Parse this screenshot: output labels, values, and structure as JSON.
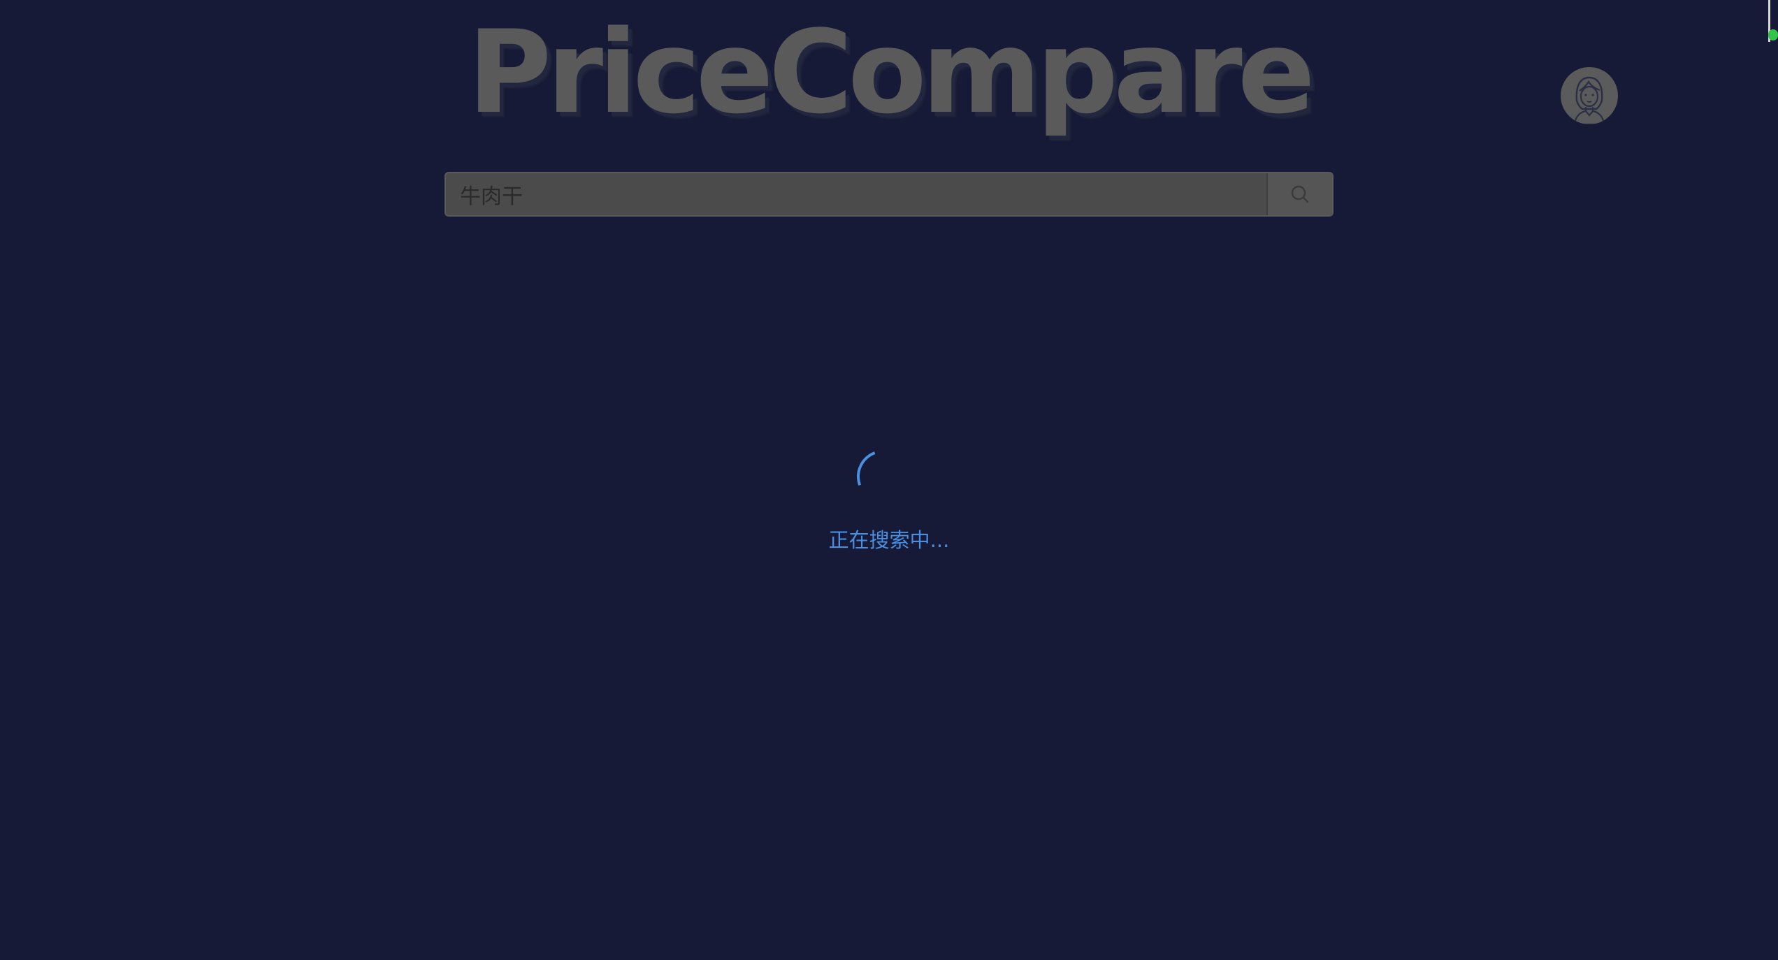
{
  "app": {
    "logo_text": "PriceCompare"
  },
  "header": {
    "avatar_icon": "user-avatar-icon"
  },
  "search": {
    "value": "牛肉干",
    "button_icon": "search-icon"
  },
  "status": {
    "loading_text": "正在搜索中...",
    "spinner_color": "#4a90e2"
  },
  "colors": {
    "background": "#161a36",
    "logo": "#5a5a5a",
    "search_bar": "#4b4b4b",
    "accent": "#4a90e2",
    "indicator": "#33c24a"
  }
}
